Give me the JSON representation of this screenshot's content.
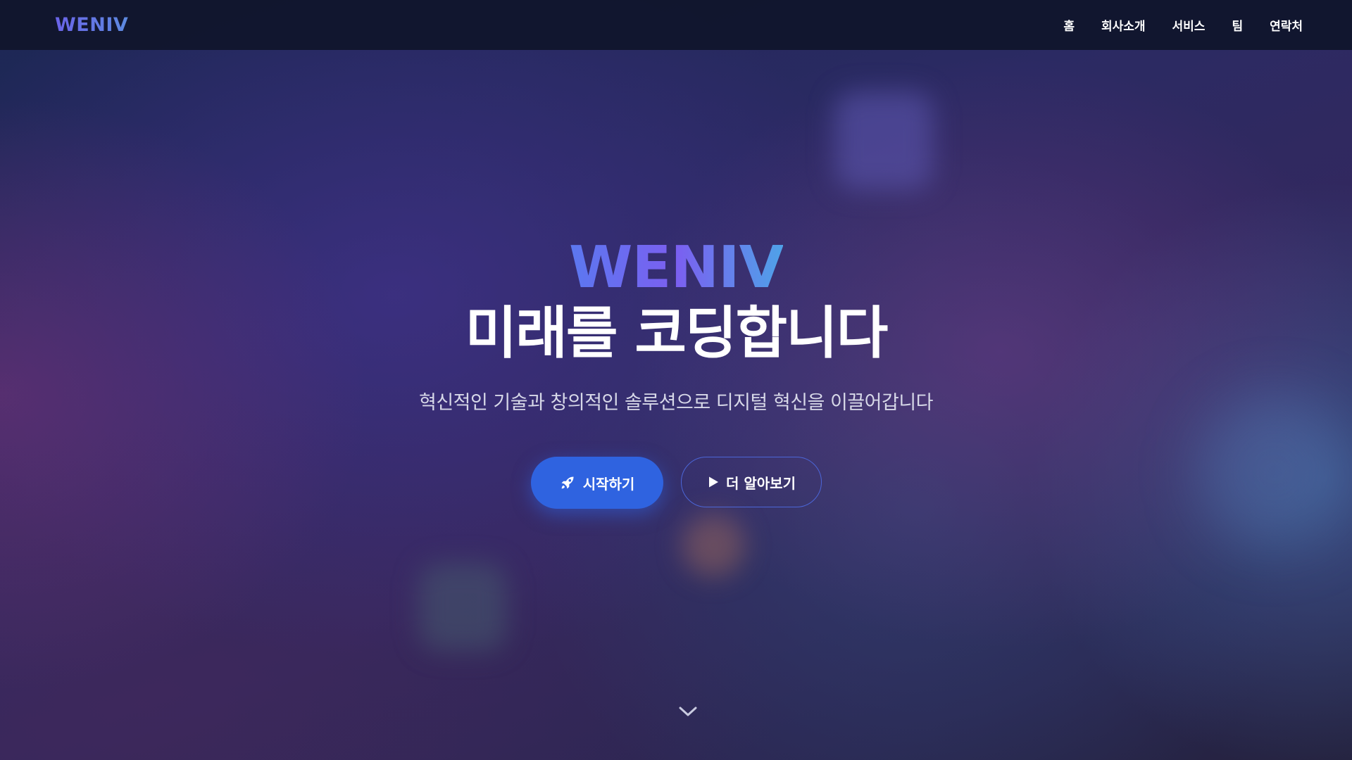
{
  "navbar": {
    "logo": "WENIV",
    "links": [
      "홈",
      "회사소개",
      "서비스",
      "팀",
      "연락처"
    ]
  },
  "hero": {
    "brand": "WENIV",
    "title": "미래를 코딩합니다",
    "subtitle": "혁신적인 기술과 창의적인 솔루션으로 디지털 혁신을 이끌어갑니다",
    "primary_button": {
      "label": "시작하기",
      "icon": "rocket-icon"
    },
    "secondary_button": {
      "label": "더 알아보기",
      "icon": "play-icon"
    }
  },
  "scroll_indicator": {
    "icon": "chevron-down-icon"
  },
  "colors": {
    "accent": "#2f63e0",
    "navbar_bg": "#11162d",
    "brand_gradient": [
      "#5b78f0",
      "#7b5ff0",
      "#4fa2e8"
    ],
    "text_primary": "#ffffff",
    "text_secondary": "#d7d8e8"
  }
}
